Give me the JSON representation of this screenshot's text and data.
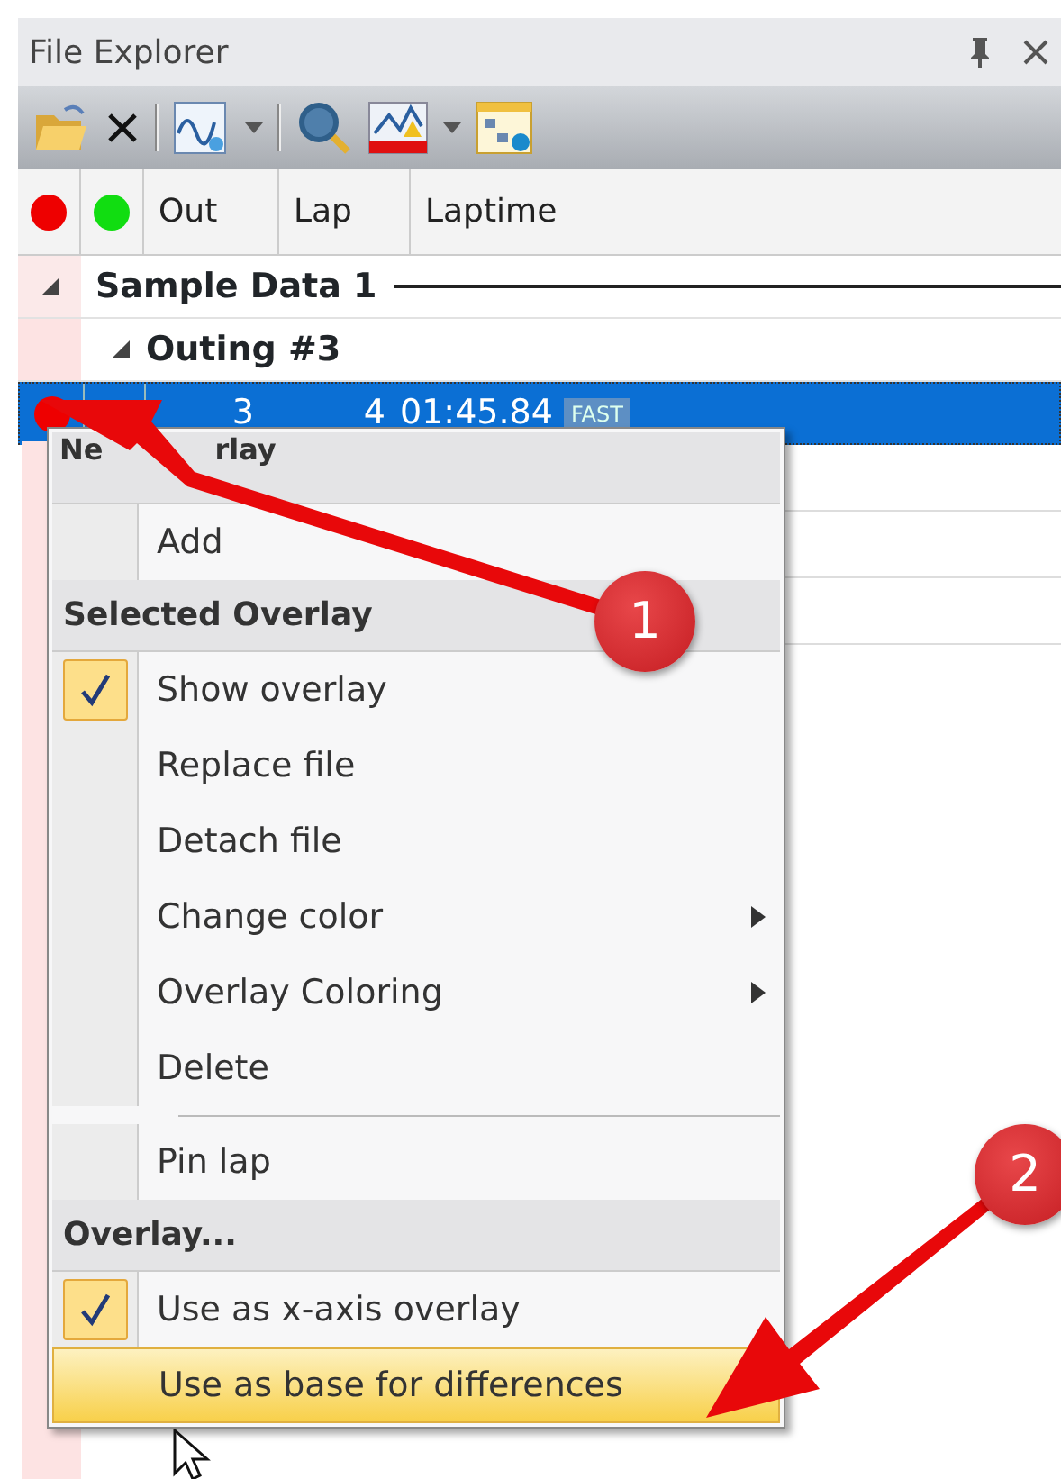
{
  "panel": {
    "title": "File Explorer"
  },
  "columns": [
    {
      "kind": "dot",
      "color": "#ee0000"
    },
    {
      "kind": "dot",
      "color": "#11dd11"
    },
    {
      "kind": "text",
      "label": "Out"
    },
    {
      "kind": "text",
      "label": "Lap"
    },
    {
      "kind": "text",
      "label": "Laptime"
    }
  ],
  "tree": [
    {
      "label": "Sample Data 1",
      "expanded": true,
      "children": [
        {
          "label": "Outing #3",
          "expanded": true,
          "children": [
            {
              "out": "3",
              "lap": "4",
              "laptime": "01:45.84",
              "tag": "FAST",
              "selected": true
            }
          ]
        }
      ]
    }
  ],
  "context_menu": [
    {
      "kind": "header",
      "label": "Ne",
      "label_continued": "rlay"
    },
    {
      "kind": "item",
      "label": "Add",
      "checked": false,
      "submenu": false,
      "selected": false
    },
    {
      "kind": "header",
      "label": "Selected Overlay"
    },
    {
      "kind": "item",
      "label": "Show overlay",
      "checked": true,
      "submenu": false,
      "selected": false
    },
    {
      "kind": "item",
      "label": "Replace file",
      "checked": false,
      "submenu": false,
      "selected": false
    },
    {
      "kind": "item",
      "label": "Detach file",
      "checked": false,
      "submenu": false,
      "selected": false
    },
    {
      "kind": "item",
      "label": "Change color",
      "checked": false,
      "submenu": true,
      "selected": false
    },
    {
      "kind": "item",
      "label": "Overlay Coloring",
      "checked": false,
      "submenu": true,
      "selected": false
    },
    {
      "kind": "item",
      "label": "Delete",
      "checked": false,
      "submenu": false,
      "selected": false
    },
    {
      "kind": "separator"
    },
    {
      "kind": "item",
      "label": "Pin lap",
      "checked": false,
      "submenu": false,
      "selected": false
    },
    {
      "kind": "header",
      "label": "Overlay..."
    },
    {
      "kind": "item",
      "label": "Use as x-axis overlay",
      "checked": true,
      "submenu": false,
      "selected": false
    },
    {
      "kind": "item",
      "label": "Use as base for differences",
      "checked": false,
      "submenu": false,
      "selected": true
    }
  ],
  "annotations": [
    {
      "label": "1"
    },
    {
      "label": "2"
    }
  ]
}
